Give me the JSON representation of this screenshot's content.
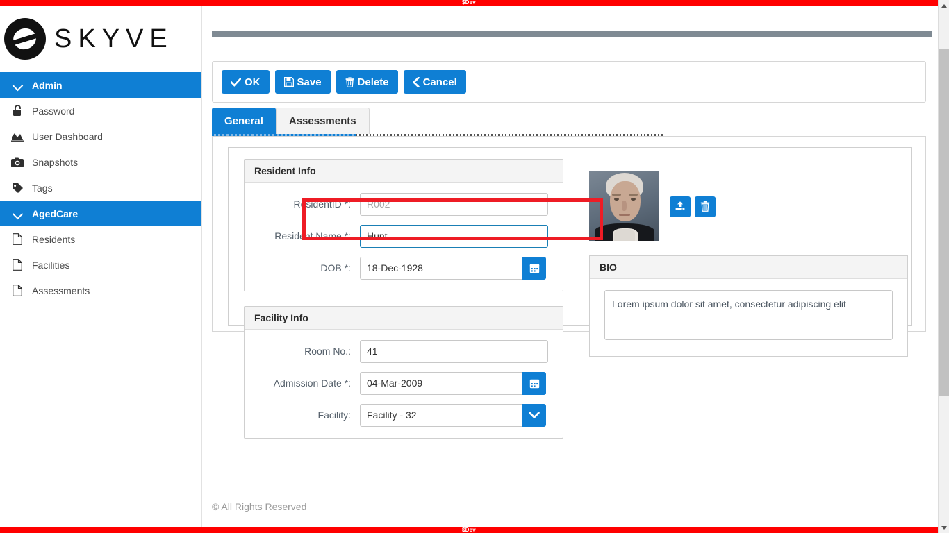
{
  "dev_ribbon": {
    "label": "$Dev",
    "color": "#ff0000"
  },
  "theme": {
    "accent": "#0f7fd4",
    "annotation": "#ee1c25",
    "panel_header_bg": "#f4f4f4"
  },
  "brand": {
    "name": "SKYVE",
    "logo_icon": "skyve-logo-icon"
  },
  "sidebar": {
    "groups": [
      {
        "label": "Admin",
        "icon": "chevron-down-icon",
        "items": [
          {
            "label": "Password",
            "icon": "lock-icon"
          },
          {
            "label": "User Dashboard",
            "icon": "chart-area-icon"
          },
          {
            "label": "Snapshots",
            "icon": "camera-icon"
          },
          {
            "label": "Tags",
            "icon": "tag-icon"
          }
        ]
      },
      {
        "label": "AgedCare",
        "icon": "chevron-down-icon",
        "items": [
          {
            "label": "Residents",
            "icon": "document-icon"
          },
          {
            "label": "Facilities",
            "icon": "document-icon"
          },
          {
            "label": "Assessments",
            "icon": "document-icon"
          }
        ]
      }
    ]
  },
  "toolbar": {
    "ok_label": "OK",
    "save_label": "Save",
    "delete_label": "Delete",
    "cancel_label": "Cancel"
  },
  "tabs": [
    {
      "label": "General",
      "active": true
    },
    {
      "label": "Assessments",
      "active": false
    }
  ],
  "form": {
    "resident_info": {
      "title": "Resident Info",
      "fields": {
        "resident_id": {
          "label": "ResidentID *:",
          "value": "",
          "placeholder": "R002",
          "highlighted": true
        },
        "resident_name": {
          "label": "Resident Name *:",
          "value": "Hunt",
          "placeholder": "",
          "focused": true
        },
        "dob": {
          "label": "DOB *:",
          "value": "18-Dec-1928",
          "placeholder": "",
          "addon_icon": "calendar-icon"
        }
      }
    },
    "facility_info": {
      "title": "Facility Info",
      "fields": {
        "room_no": {
          "label": "Room No.:",
          "value": "41",
          "placeholder": ""
        },
        "admission_date": {
          "label": "Admission Date *:",
          "value": "04-Mar-2009",
          "placeholder": "",
          "addon_icon": "calendar-icon"
        },
        "facility": {
          "label": "Facility:",
          "value": "Facility - 32",
          "placeholder": "",
          "addon_icon": "chevron-down-icon"
        }
      }
    },
    "photo": {
      "alt": "resident-photo",
      "upload_icon": "upload-icon",
      "delete_icon": "trash-icon"
    },
    "bio": {
      "title": "BIO",
      "value": "Lorem ipsum dolor sit amet, consectetur adipiscing elit",
      "placeholder": ""
    }
  },
  "footer": {
    "copyright": "© All Rights Reserved"
  }
}
